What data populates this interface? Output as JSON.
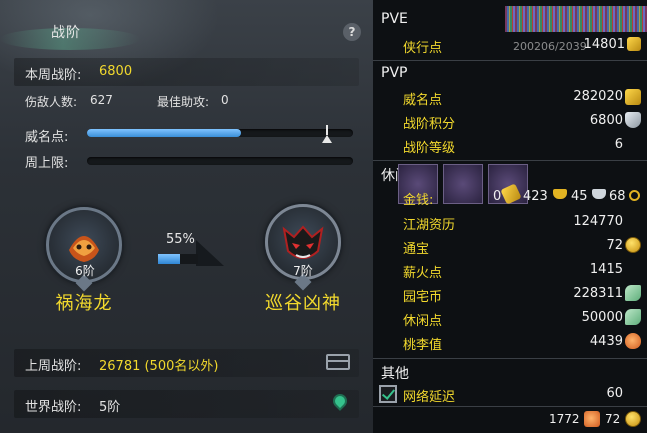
{
  "left_panel": {
    "title": "战阶",
    "help_label": "?",
    "weekly_rank_label": "本周战阶:",
    "weekly_rank_value": "6800",
    "damage_count_label": "伤敌人数:",
    "damage_count_value": "627",
    "best_assist_label": "最佳助攻:",
    "best_assist_value": "0",
    "prestige_label": "威名点:",
    "prestige_fill_fraction": 0.58,
    "weekly_cap_label": "周上限:",
    "weekly_cap_fill_fraction": 0.0,
    "current_rank": {
      "level": "6阶",
      "name": "祸海龙"
    },
    "progress_percent_text": "55%",
    "progress_fraction": 0.55,
    "next_rank": {
      "level": "7阶",
      "name": "巡谷凶神"
    },
    "last_week_label": "上周战阶:",
    "last_week_value": "26781 (500名以外)",
    "world_rank_label": "世界战阶:",
    "world_rank_value": "5阶"
  },
  "right_panel": {
    "pve": {
      "header": "PVE",
      "rows": [
        {
          "label": "侠行点",
          "value": "14801"
        }
      ]
    },
    "pvp": {
      "header": "PVP",
      "rows": [
        {
          "label": "威名点",
          "value": "282020"
        },
        {
          "label": "战阶积分",
          "value": "6800"
        },
        {
          "label": "战阶等级",
          "value": "6"
        }
      ]
    },
    "leisure": {
      "header": "休闲",
      "money_label": "金钱:",
      "money_values": [
        "0",
        "423",
        "45",
        "68"
      ],
      "rows": [
        {
          "label": "江湖资历",
          "value": "124770"
        },
        {
          "label": "通宝",
          "value": "72"
        },
        {
          "label": "薪火点",
          "value": "1415"
        },
        {
          "label": "园宅币",
          "value": "228311"
        },
        {
          "label": "休闲点",
          "value": "50000"
        },
        {
          "label": "桃李值",
          "value": "4439"
        }
      ]
    },
    "other": {
      "header": "其他",
      "rows": [
        {
          "label": "网络延迟",
          "value": "60"
        }
      ]
    },
    "footer": {
      "value_left": "1772",
      "value_right": "72"
    },
    "background_text": "200206/2039"
  },
  "colors": {
    "accent_yellow": "#f2d92d",
    "progress_blue": "#3a8fd8",
    "panel_dark": "#0c0e10"
  }
}
